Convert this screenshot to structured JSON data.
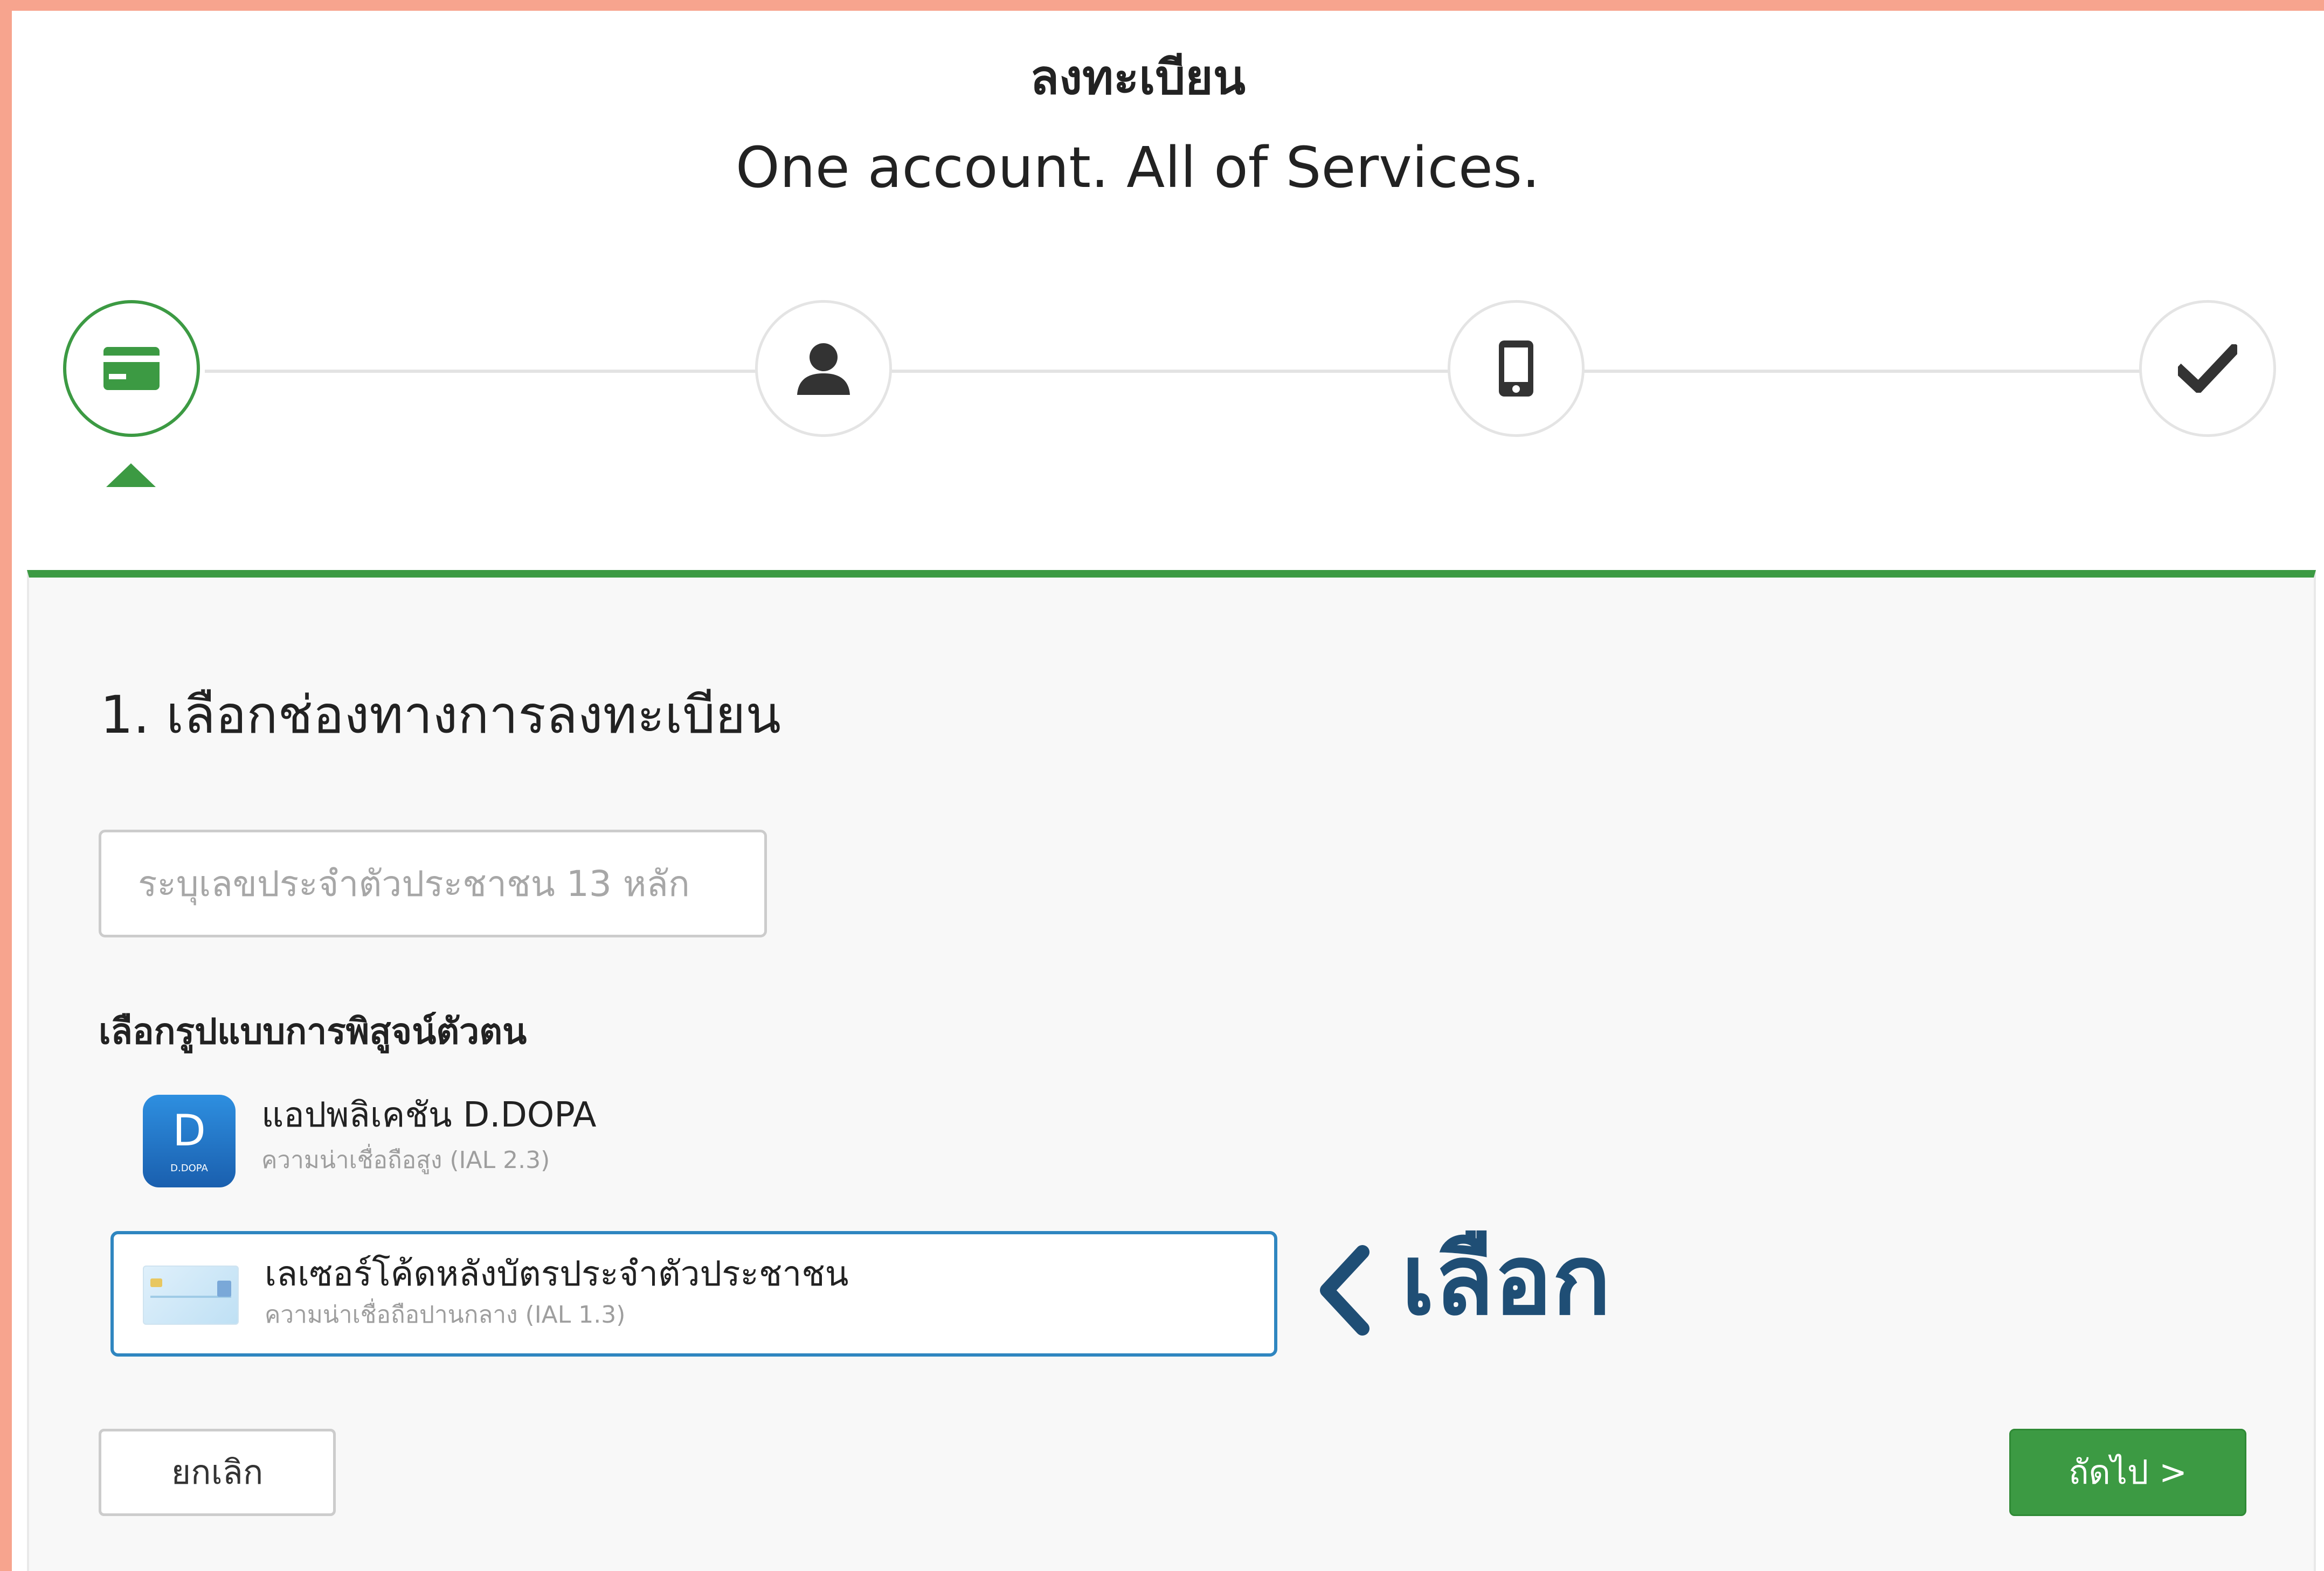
{
  "header": {
    "title": "ลงทะเบียน",
    "subtitle": "One account. All of Services."
  },
  "stepper": {
    "active_step": 1,
    "steps": [
      {
        "icon": "id-card-icon"
      },
      {
        "icon": "user-icon"
      },
      {
        "icon": "mobile-phone-icon"
      },
      {
        "icon": "checkmark-icon"
      }
    ]
  },
  "form": {
    "section_title": "1. เลือกช่องทางการลงทะเบียน",
    "id_input": {
      "placeholder": "ระบุเลขประจำตัวประชาชน 13 หลัก",
      "value": ""
    },
    "method_label": "เลือกรูปแบบการพิสูจน์ตัวตน",
    "options": [
      {
        "icon_letter": "D",
        "icon_caption": "D.DOPA",
        "title": "แอปพลิเคชัน D.DOPA",
        "subtitle": "ความน่าเชื่อถือสูง (IAL 2.3)",
        "selected": false
      },
      {
        "icon": "id-card-image",
        "title": "เลเซอร์โค้ดหลังบัตรประจำตัวประชาชน",
        "subtitle": "ความน่าเชื่อถือปานกลาง (IAL 1.3)",
        "selected": true
      }
    ]
  },
  "annotation": {
    "label": "เลือก",
    "color": "#1f4e75"
  },
  "buttons": {
    "cancel": "ยกเลิก",
    "next": "ถัดไป >"
  },
  "colors": {
    "accent_green": "#3c9a43",
    "selected_border": "#2f86c0",
    "frame": "#f7a48e"
  }
}
